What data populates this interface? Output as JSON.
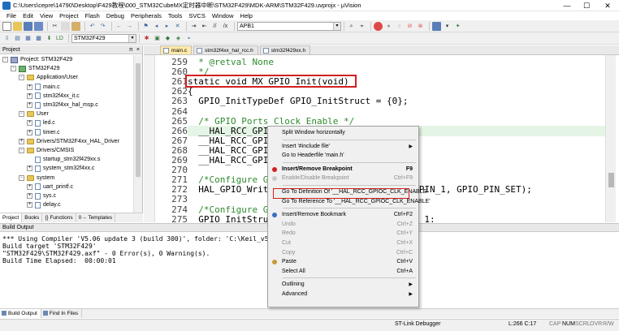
{
  "window": {
    "title": "C:\\Users\\cepre\\14790\\Desktop\\F429教程\\000_STM32CubeMX定时器中断\\STM32F429\\MDK-ARM\\STM32F429.uvprojx - µVision",
    "controls": {
      "minimize": "—",
      "maximize": "☐",
      "close": "✕"
    }
  },
  "menubar": [
    "File",
    "Edit",
    "View",
    "Project",
    "Flash",
    "Debug",
    "Peripherals",
    "Tools",
    "SVCS",
    "Window",
    "Help"
  ],
  "toolbar": {
    "find_combo": "APB1",
    "target_combo": "STM32F429"
  },
  "project_panel": {
    "header": "Project",
    "pin": "ᴨ",
    "close": "×",
    "tree": [
      {
        "label": "Project: STM32F429",
        "level": 0,
        "kind": "project",
        "expander": "-"
      },
      {
        "label": "STM32F429",
        "level": 1,
        "kind": "target",
        "expander": "-"
      },
      {
        "label": "Application/User",
        "level": 2,
        "kind": "folder",
        "expander": "-"
      },
      {
        "label": "main.c",
        "level": 3,
        "kind": "file",
        "expander": "+"
      },
      {
        "label": "stm32f4xx_it.c",
        "level": 3,
        "kind": "file",
        "expander": "+"
      },
      {
        "label": "stm32f4xx_hal_msp.c",
        "level": 3,
        "kind": "file",
        "expander": "+"
      },
      {
        "label": "User",
        "level": 2,
        "kind": "folder",
        "expander": "-"
      },
      {
        "label": "led.c",
        "level": 3,
        "kind": "file",
        "expander": "+"
      },
      {
        "label": "timer.c",
        "level": 3,
        "kind": "file",
        "expander": "+"
      },
      {
        "label": "Drivers/STM32F4xx_HAL_Driver",
        "level": 2,
        "kind": "folder",
        "expander": "+"
      },
      {
        "label": "Drivers/CMSIS",
        "level": 2,
        "kind": "folder",
        "expander": "-"
      },
      {
        "label": "startup_stm32f429xx.s",
        "level": 3,
        "kind": "file",
        "expander": ""
      },
      {
        "label": "system_stm32f4xx.c",
        "level": 3,
        "kind": "file",
        "expander": "+"
      },
      {
        "label": "system",
        "level": 2,
        "kind": "folder",
        "expander": "-"
      },
      {
        "label": "uart_printf.c",
        "level": 3,
        "kind": "file",
        "expander": "+"
      },
      {
        "label": "sys.c",
        "level": 3,
        "kind": "file",
        "expander": "+"
      },
      {
        "label": "delay.c",
        "level": 3,
        "kind": "file",
        "expander": "+"
      }
    ],
    "tabs": [
      "Project",
      "Books",
      "{} Functions",
      "0→ Templates"
    ]
  },
  "editor": {
    "tabs": [
      "main.c",
      "stm32f4xx_hal_rcc.h",
      "stm32f429xx.h"
    ],
    "active_tab": 0,
    "line_numbers": [
      "259",
      "260",
      "261",
      "262",
      "263",
      "264",
      "265",
      "266",
      "267",
      "268",
      "269",
      "270",
      "271",
      "272",
      "273",
      "274",
      "275"
    ],
    "lines": [
      {
        "text": "  * @retval None",
        "cls": "cmt"
      },
      {
        "text": "  */",
        "cls": "cmt"
      },
      {
        "text": "static void MX_GPIO_Init(void)",
        "cls": ""
      },
      {
        "text": "{",
        "cls": ""
      },
      {
        "text": "  GPIO_InitTypeDef GPIO_InitStruct = {0};",
        "cls": ""
      },
      {
        "text": "",
        "cls": ""
      },
      {
        "text": "  /* GPIO Ports Clock Enable */",
        "cls": "cmt"
      },
      {
        "text": "  __HAL_RCC_GPIOC_CLK_ENABLE();",
        "cls": ""
      },
      {
        "text": "  __HAL_RCC_GPIOH_CLK_ENABLE();",
        "cls": ""
      },
      {
        "text": "  __HAL_RCC_GPIOB_CLK_ENABLE();",
        "cls": ""
      },
      {
        "text": "  __HAL_RCC_GPIOA_CLK_ENABLE();",
        "cls": ""
      },
      {
        "text": "",
        "cls": ""
      },
      {
        "text": "  /*Configure GPIO pin Output Level */",
        "cls": "cmt"
      },
      {
        "text": "  HAL_GPIO_WritePin(GPIOB, GPIO_PIN_0|GPIO_PIN_1, GPIO_PIN_SET);",
        "cls": ""
      },
      {
        "text": "",
        "cls": ""
      },
      {
        "text": "  /*Configure GPIO pins : PB0 PB1 */",
        "cls": "cmt"
      },
      {
        "text": "  GPIO_InitStruct.Pin = GPIO_PIN_0|GPIO_PIN_1;",
        "cls": ""
      }
    ]
  },
  "build_output": {
    "header": "Build Output",
    "lines": [
      "*** Using Compiler 'V5.06 update 3 (build 300)', folder: 'C:\\Keil_v5\\ARM\\ARMCC\\Bin'",
      "Build target 'STM32F429'",
      "\"STM32F429\\STM32F429.axf\" - 0 Error(s), 0 Warning(s).",
      "Build Time Elapsed:  00:00:01"
    ],
    "tabs": [
      "Build Output",
      "Find In Files"
    ]
  },
  "statusbar": {
    "debugger": "ST-Link Debugger",
    "position": "L:266 C:17",
    "indicators": [
      "CAP",
      "NUM",
      "SCRL",
      "OVR",
      "R/W"
    ]
  },
  "context_menu": {
    "items": [
      {
        "label": "Split Window horizontally",
        "shortcut": "",
        "state": "normal",
        "icon": "",
        "submenu": false
      },
      {
        "sep": true
      },
      {
        "label": "Insert '#include file'",
        "shortcut": "",
        "state": "normal",
        "icon": "",
        "submenu": true
      },
      {
        "label": "Go to Headerfile 'main.h'",
        "shortcut": "",
        "state": "normal",
        "icon": "",
        "submenu": false
      },
      {
        "sep": true
      },
      {
        "label": "Insert/Remove Breakpoint",
        "shortcut": "F9",
        "state": "bold",
        "icon": "#d02020",
        "submenu": false
      },
      {
        "label": "Enable/Disable Breakpoint",
        "shortcut": "Ctrl+F9",
        "state": "disabled",
        "icon": "#c9c9c9",
        "submenu": false
      },
      {
        "sep": true
      },
      {
        "label": "Go To Definition Of '__HAL_RCC_GPIOC_CLK_ENABLE'",
        "shortcut": "",
        "state": "normal",
        "icon": "",
        "submenu": false
      },
      {
        "label": "Go To Reference To '__HAL_RCC_GPIOC_CLK_ENABLE'",
        "shortcut": "",
        "state": "normal",
        "icon": "",
        "submenu": false
      },
      {
        "sep": true
      },
      {
        "label": "Insert/Remove Bookmark",
        "shortcut": "Ctrl+F2",
        "state": "normal",
        "icon": "#3a6fc0",
        "submenu": false
      },
      {
        "label": "Undo",
        "shortcut": "Ctrl+Z",
        "state": "disabled",
        "icon": "",
        "submenu": false
      },
      {
        "label": "Redo",
        "shortcut": "Ctrl+Y",
        "state": "disabled",
        "icon": "",
        "submenu": false
      },
      {
        "label": "Cut",
        "shortcut": "Ctrl+X",
        "state": "disabled",
        "icon": "",
        "submenu": false
      },
      {
        "label": "Copy",
        "shortcut": "Ctrl+C",
        "state": "disabled",
        "icon": "",
        "submenu": false
      },
      {
        "label": "Paste",
        "shortcut": "Ctrl+V",
        "state": "normal",
        "icon": "#c99a3a",
        "submenu": false
      },
      {
        "label": "Select All",
        "shortcut": "Ctrl+A",
        "state": "normal",
        "icon": "",
        "submenu": false
      },
      {
        "sep": true
      },
      {
        "label": "Outlining",
        "shortcut": "",
        "state": "normal",
        "icon": "",
        "submenu": true
      },
      {
        "label": "Advanced",
        "shortcut": "",
        "state": "normal",
        "icon": "",
        "submenu": true
      }
    ]
  },
  "colors": {
    "comment": "#2e8b2e",
    "highlight_box": "#d02020",
    "active_tab": "#ffe9a8",
    "current_line": "#e5f5e5"
  }
}
